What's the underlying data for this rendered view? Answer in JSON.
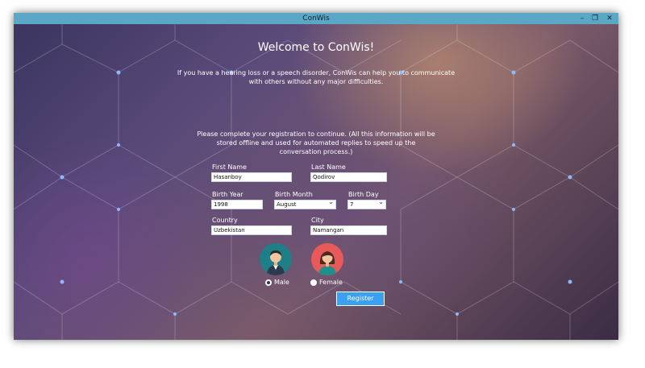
{
  "window": {
    "title": "ConWis",
    "controls": {
      "minimize": "–",
      "maximize": "❐",
      "close": "✕"
    }
  },
  "header": {
    "title": "Welcome to ConWis!",
    "intro": "If you have a hearing loss or a speech disorder, ConWis can help you to communicate with others without any major difficulties."
  },
  "form": {
    "instructions": "Please complete your registration to continue. (All this information will be stored offline and used for automated replies to speed up the conversation process.)",
    "first_name": {
      "label": "First Name",
      "value": "Hasanboy"
    },
    "last_name": {
      "label": "Last Name",
      "value": "Qodirov"
    },
    "birth_year": {
      "label": "Birth Year",
      "value": "1998"
    },
    "birth_month": {
      "label": "Birth Month",
      "value": "August"
    },
    "birth_day": {
      "label": "Birth Day",
      "value": "7"
    },
    "country": {
      "label": "Country",
      "value": "Uzbekistan"
    },
    "city": {
      "label": "City",
      "value": "Namangan"
    },
    "gender": {
      "options": [
        {
          "label": "Male",
          "icon": "male-avatar-icon",
          "selected": true
        },
        {
          "label": "Female",
          "icon": "female-avatar-icon",
          "selected": false
        }
      ]
    },
    "register_label": "Register"
  },
  "colors": {
    "titlebar": "#5aa7c6",
    "button": "#3ba0f0",
    "male_avatar_bg": "#1e7f86",
    "female_avatar_bg": "#e85a5a"
  }
}
